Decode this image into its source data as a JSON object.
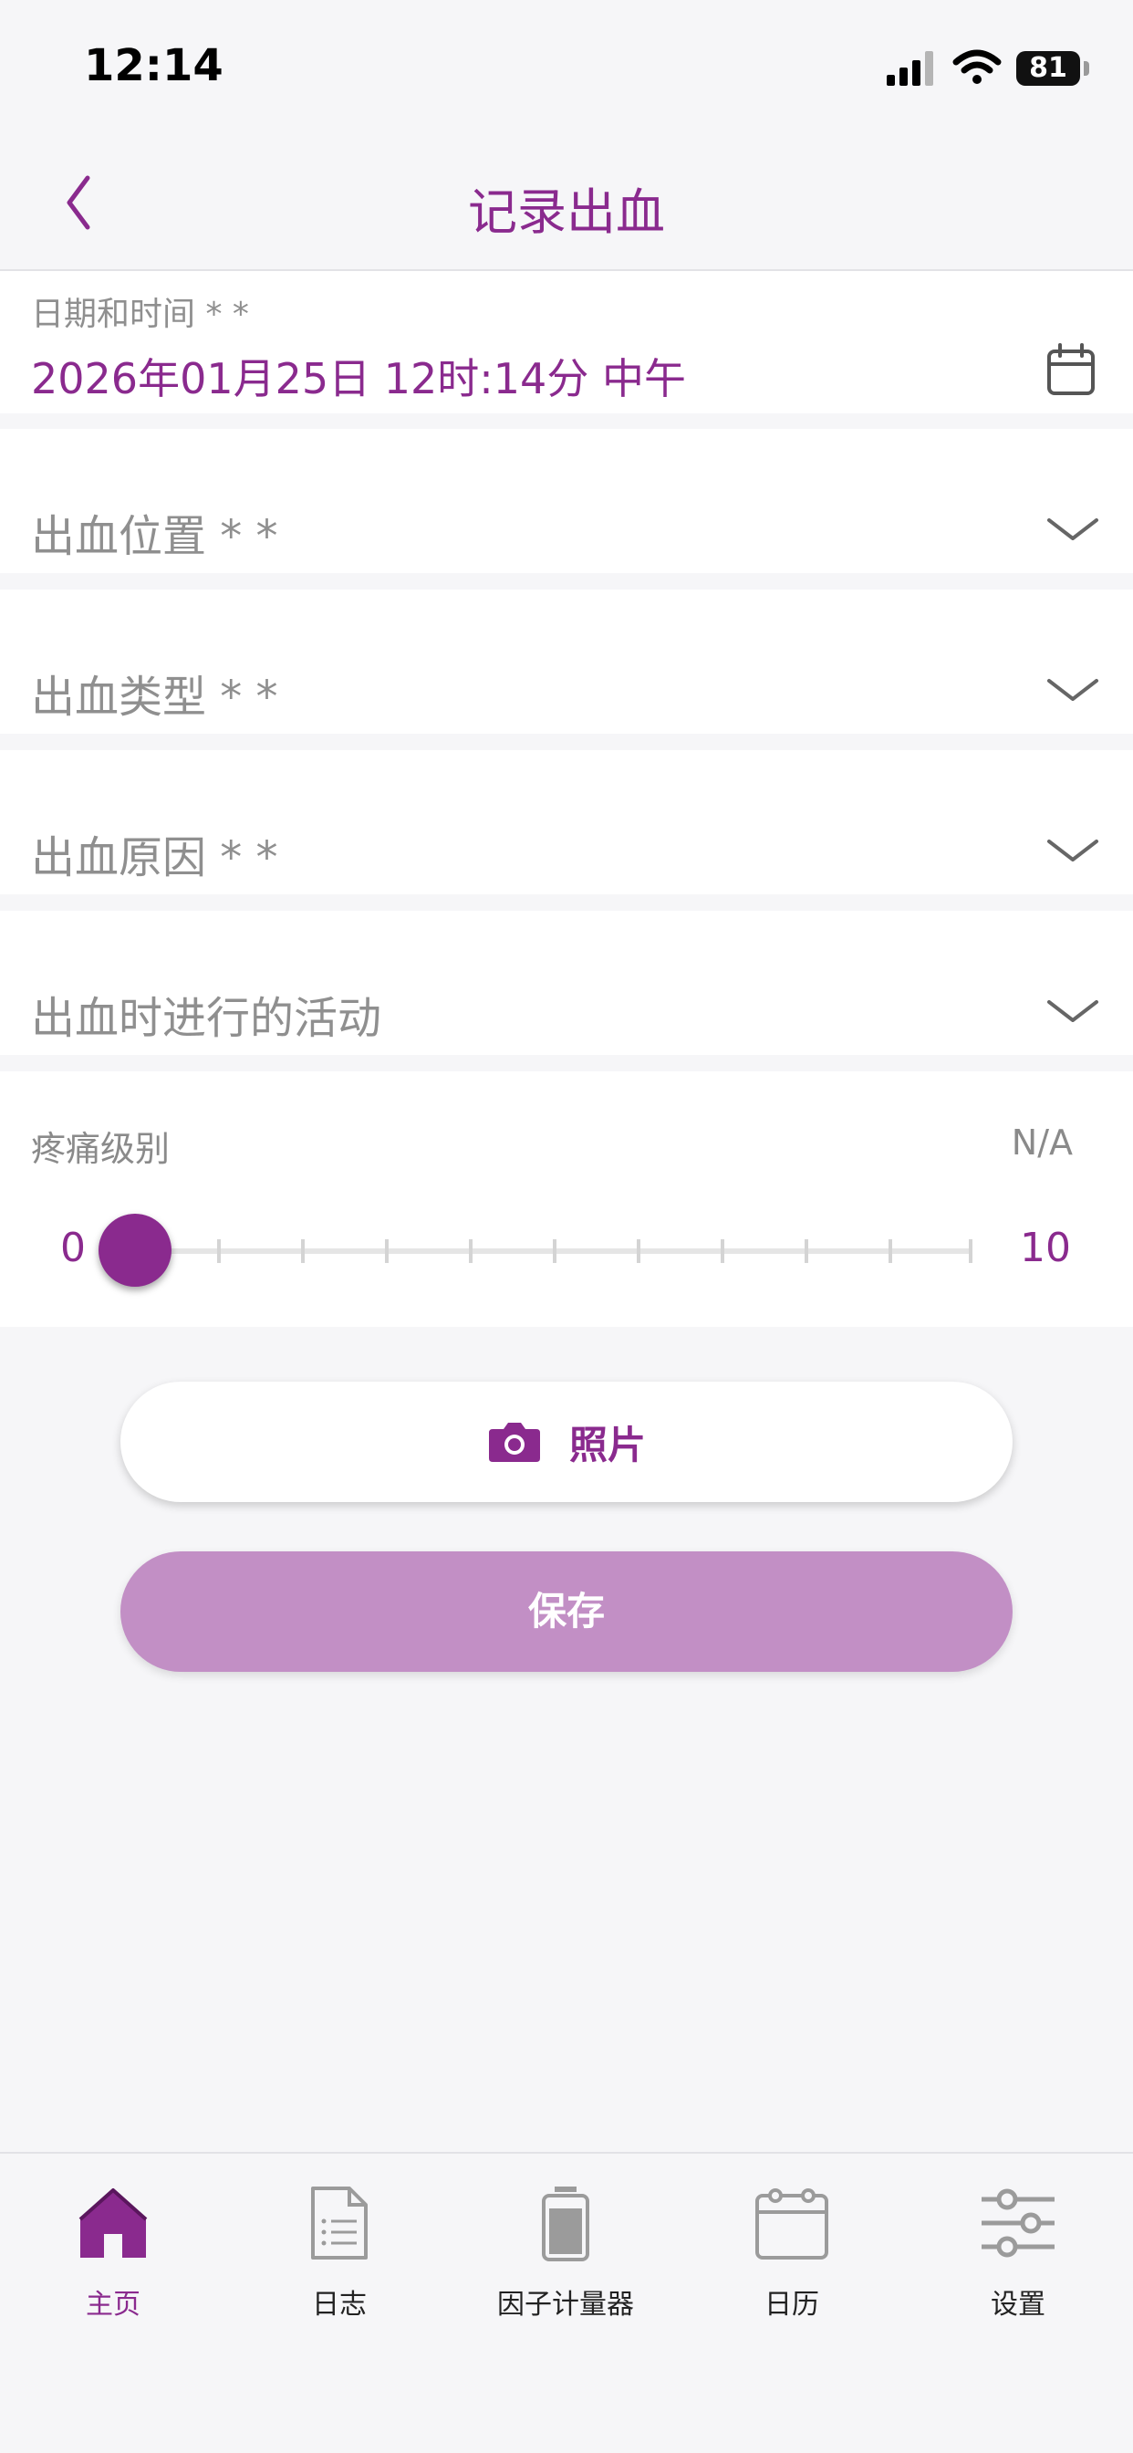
{
  "status_bar": {
    "time": "12:14",
    "battery": "81"
  },
  "nav": {
    "title": "记录出血"
  },
  "datetime": {
    "label": "日期和时间 * *",
    "value": "2026年01月25日 12时:14分 中午"
  },
  "selects": [
    {
      "label": "出血位置 * *"
    },
    {
      "label": "出血类型 * *"
    },
    {
      "label": "出血原因 * *"
    },
    {
      "label": "出血时进行的活动"
    }
  ],
  "pain": {
    "label": "疼痛级别",
    "value": "N/A",
    "min": "0",
    "max": "10",
    "level": 0
  },
  "buttons": {
    "photo": "照片",
    "save": "保存"
  },
  "tabs": [
    {
      "label": "主页",
      "icon": "home-icon",
      "active": true
    },
    {
      "label": "日志",
      "icon": "log-icon",
      "active": false
    },
    {
      "label": "因子计量器",
      "icon": "factor-meter-icon",
      "active": false
    },
    {
      "label": "日历",
      "icon": "calendar-icon",
      "active": false
    },
    {
      "label": "设置",
      "icon": "settings-icon",
      "active": false
    }
  ],
  "colors": {
    "accent": "#8a2a8e",
    "save_button": "#c28fc5",
    "background": "#f6f6f8"
  }
}
